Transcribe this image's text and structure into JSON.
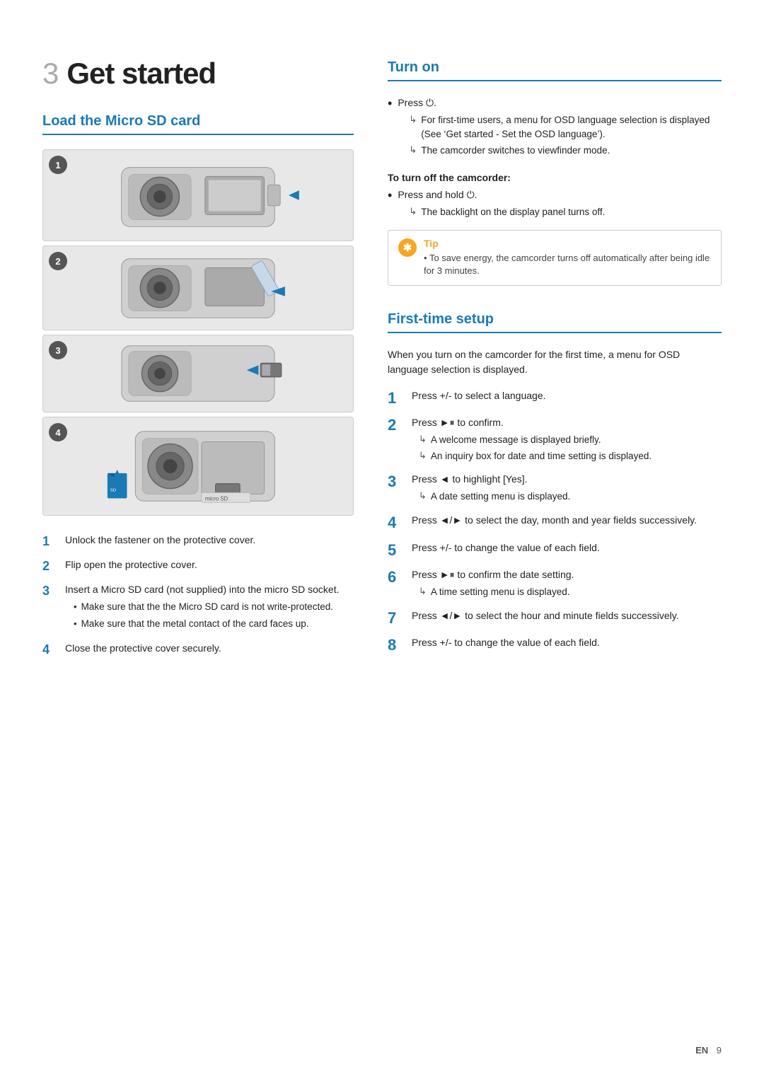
{
  "page": {
    "number": "9",
    "lang": "EN"
  },
  "chapter": {
    "number": "3",
    "title": "Get started"
  },
  "left": {
    "section_title": "Load the Micro SD card",
    "steps": [
      {
        "num": "1",
        "text": "Unlock the fastener on the protective cover."
      },
      {
        "num": "2",
        "text": "Flip open the protective cover."
      },
      {
        "num": "3",
        "text": "Insert a Micro SD card (not supplied) into the micro SD socket.",
        "bullets": [
          "Make sure that the the Micro SD card is not write-protected.",
          "Make sure that the metal contact of the card faces up."
        ]
      },
      {
        "num": "4",
        "text": "Close the protective cover securely."
      }
    ]
  },
  "right": {
    "turn_on": {
      "section_title": "Turn on",
      "items": [
        {
          "type": "main",
          "text": "Press ⏻.",
          "sub": [
            "For first-time users, a menu for OSD language selection is displayed (See ‘Get started - Set the OSD language’).",
            "The camcorder switches to viewfinder mode."
          ]
        }
      ],
      "to_turn_off": {
        "title": "To turn off the camcorder:",
        "items": [
          {
            "type": "main",
            "text": "Press and hold ⏻.",
            "sub": [
              "The backlight on the display panel turns off."
            ]
          }
        ]
      },
      "tip": {
        "label": "Tip",
        "text": "To save energy, the camcorder turns off automatically after being idle for 3 minutes."
      }
    },
    "first_time": {
      "section_title": "First-time setup",
      "intro": "When you turn on the camcorder for the first time, a menu for OSD language selection is displayed.",
      "steps": [
        {
          "num": "1",
          "text": "Press +/- to select a language."
        },
        {
          "num": "2",
          "text": "Press ►⏸ to confirm.",
          "sub": [
            "A welcome message is displayed briefly.",
            "An inquiry box for date and time setting is displayed."
          ]
        },
        {
          "num": "3",
          "text": "Press ◄ to highlight [Yes].",
          "sub": [
            "A date setting menu is displayed."
          ]
        },
        {
          "num": "4",
          "text": "Press ◄/► to select the day, month and year fields successively."
        },
        {
          "num": "5",
          "text": "Press +/- to change the value of each field."
        },
        {
          "num": "6",
          "text": "Press ►⏸ to confirm the date setting.",
          "sub": [
            "A time setting menu is displayed."
          ]
        },
        {
          "num": "7",
          "text": "Press ◄/► to select the hour and minute fields successively."
        },
        {
          "num": "8",
          "text": "Press +/- to change the value of each field."
        }
      ]
    }
  }
}
